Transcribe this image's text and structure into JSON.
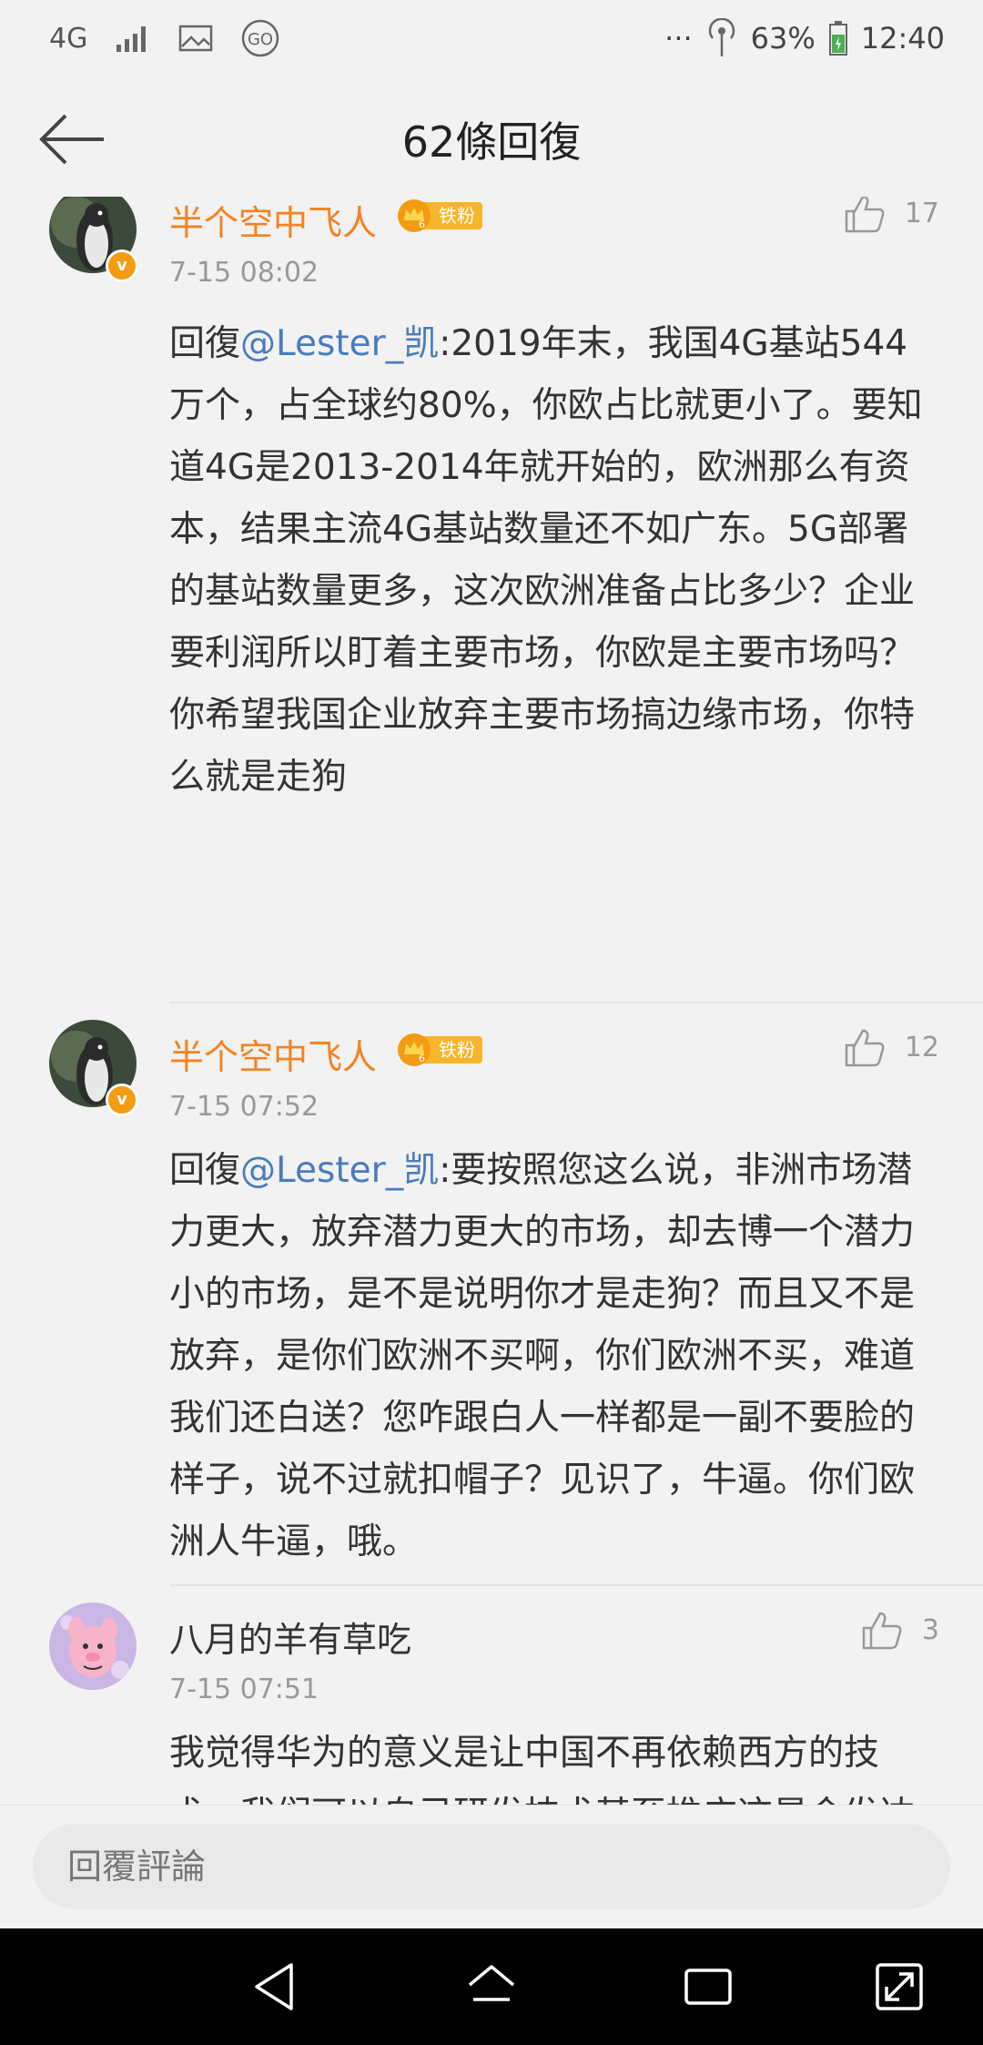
{
  "status_bar": {
    "network": "4G",
    "battery": "63%",
    "time": "12:40",
    "more": "···",
    "icons": [
      "4g-icon",
      "signal-icon",
      "image-icon",
      "go-icon",
      "hotspot-icon",
      "battery-icon"
    ]
  },
  "header": {
    "title": "62條回復",
    "back_icon": "back-arrow-icon"
  },
  "comments": [
    {
      "username": "半个空中飞人",
      "badge": "铁粉",
      "badge_level": "6",
      "time": "7-15 08:02",
      "likes": "17",
      "reply_prefix": "回復",
      "mention": "@Lester_凯",
      "text": ":2019年末，我国4G基站544万个，占全球约80%，你欧占比就更小了。要知道4G是2013-2014年就开始的，欧洲那么有资本，结果主流4G基站数量还不如广东。5G部署的基站数量更多，这次欧洲准备占比多少？企业要利润所以盯着主要市场，你欧是主要市场吗？你希望我国企业放弃主要市场搞边缘市场，你特么就是走狗"
    },
    {
      "username": "半个空中飞人",
      "badge": "铁粉",
      "badge_level": "6",
      "time": "7-15 07:52",
      "likes": "12",
      "reply_prefix": "回復",
      "mention": "@Lester_凯",
      "text": ":要按照您这么说，非洲市场潜力更大，放弃潜力更大的市场，却去博一个潜力小的市场，是不是说明你才是走狗？而且又不是放弃，是你们欧洲不买啊，你们欧洲不买，难道我们还白送？您咋跟白人一样都是一副不要脸的样子，说不过就扣帽子？见识了，牛逼。你们欧洲人牛逼，哦。"
    },
    {
      "username": "八月的羊有草吃",
      "time": "7-15 07:51",
      "likes": "3",
      "text": "我觉得华为的意义是让中国不再依赖西方的技术，我们可以自己研发技术甚至推广这是令发达国家害怕的，当然海外市场份额也是要争取的，但整个欧洲的份额才多大。。"
    }
  ],
  "reply_input": {
    "placeholder": "回覆評論"
  },
  "colors": {
    "username_highlight": "#f58220",
    "mention": "#4a7cbc",
    "badge": "#f7b52c",
    "background": "#f2f2f2"
  }
}
